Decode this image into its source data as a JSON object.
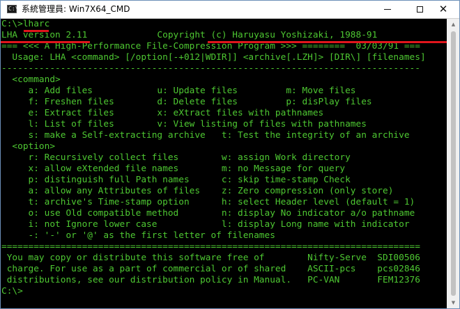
{
  "window": {
    "title": "系統管理員: Win7X64_CMD",
    "icon_label": "C:\\",
    "controls": {
      "minimize": "minimize-icon",
      "maximize": "maximize-icon",
      "close": "close-icon"
    }
  },
  "console": {
    "prompt_line": "C:\\>lharc",
    "lines": [
      "LHA version 2.11             Copyright (c) Haruyasu Yoshizaki, 1988-91",
      "=== <<< A High-Performance File-Compression Program >>> ========  03/03/91 ===",
      "  Usage: LHA <command> [/option[-+012|WDIR]] <archive[.LZH]> [DIR\\] [filenames]",
      "------------------------------------------------------------------------------",
      "  <command>",
      "     a: Add files            u: Update files         m: Move files",
      "     f: Freshen files        d: Delete files         p: disPlay files",
      "     e: Extract files        x: eXtract files with pathnames",
      "     l: List of files        v: View listing of files with pathnames",
      "     s: make a Self-extracting archive   t: Test the integrity of an archive",
      "  <option>",
      "     r: Recursively collect files        w: assign Work directory",
      "     x: allow eXtended file names        m: no Message for query",
      "     p: distinguish full Path names      c: skip time-stamp Check",
      "     a: allow any Attributes of files    z: Zero compression (only store)",
      "     t: archive's Time-stamp option      h: select Header level (default = 1)",
      "     o: use Old compatible method        n: display No indicator a/o pathname",
      "     i: not Ignore lower case            l: display Long name with indicator",
      "     -: '-' or '@' as the first letter of filenames",
      "==============================================================================",
      " You may copy or distribute this software free of        Nifty-Serve  SDI00506",
      " charge. For use as a part of commercial or of shared    ASCII-pcs    pcs02846",
      " distributions, see our distribution policy in Manual.   PC-VAN       FEM12376",
      "C:\\>"
    ]
  },
  "colors": {
    "console_bg": "#000000",
    "console_text": "#4ec832",
    "highlight": "#e0151c",
    "titlebar": "#ffffff"
  }
}
